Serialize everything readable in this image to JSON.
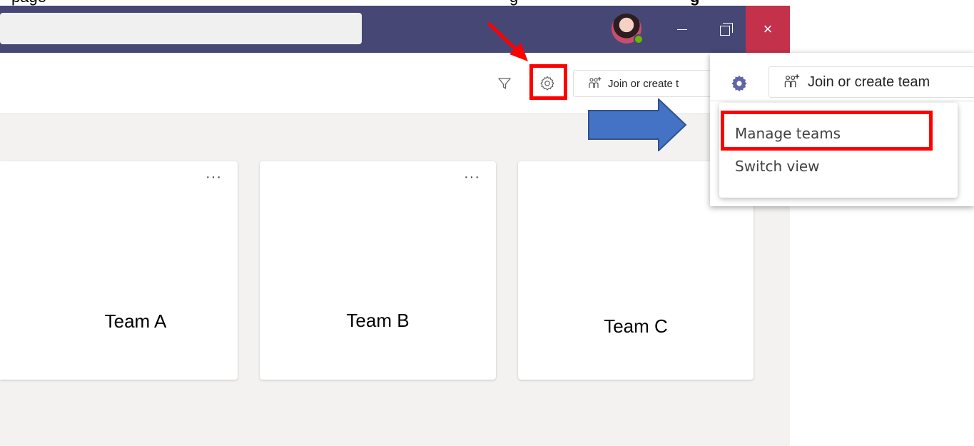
{
  "doc_caption": {
    "left_text": "page",
    "middle_text": "g",
    "right_text": "g"
  },
  "titlebar": {
    "search_placeholder": "",
    "minimize_icon": "minimize-icon",
    "maximize_icon": "restore-icon",
    "close_glyph": "×",
    "bar_color": "#464775",
    "close_color": "#c4314b"
  },
  "header": {
    "filter_icon": "filter-icon",
    "settings_icon": "gear-icon",
    "join_label": "Join or create t"
  },
  "teams": [
    {
      "name": "Team A",
      "more": "···"
    },
    {
      "name": "Team B",
      "more": "···"
    },
    {
      "name": "Team C",
      "more": ""
    }
  ],
  "inset": {
    "join_label": "Join or create team",
    "menu": [
      {
        "label": "Manage teams"
      },
      {
        "label": "Switch view"
      }
    ],
    "gear_color": "#6264a7"
  },
  "annotations": {
    "highlight_color": "#ff0000",
    "arrow_red": "#ff0000",
    "arrow_blue": "#4472c4"
  }
}
